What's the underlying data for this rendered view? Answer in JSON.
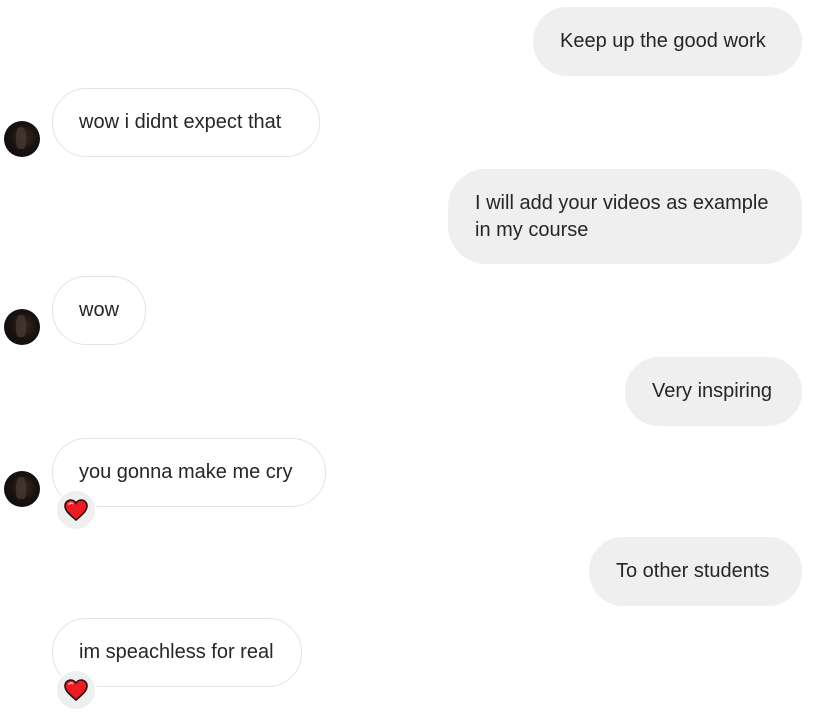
{
  "conversation": {
    "messages": [
      {
        "direction": "sent",
        "text": "Keep up the good work"
      },
      {
        "direction": "received",
        "text": "wow i didnt expect that"
      },
      {
        "direction": "sent",
        "text": "I will add your videos as example in my course"
      },
      {
        "direction": "received",
        "text": "wow"
      },
      {
        "direction": "sent",
        "text": "Very inspiring"
      },
      {
        "direction": "received",
        "text": "you gonna make me cry",
        "reaction": "heart-icon"
      },
      {
        "direction": "sent",
        "text": "To other students"
      },
      {
        "direction": "received",
        "text": "im speachless for real",
        "reaction": "heart-icon"
      }
    ]
  },
  "colors": {
    "sent_bubble": "#efefef",
    "received_bubble_border": "#e3e3e3",
    "text": "#262626",
    "heart": "#ed1c24"
  }
}
